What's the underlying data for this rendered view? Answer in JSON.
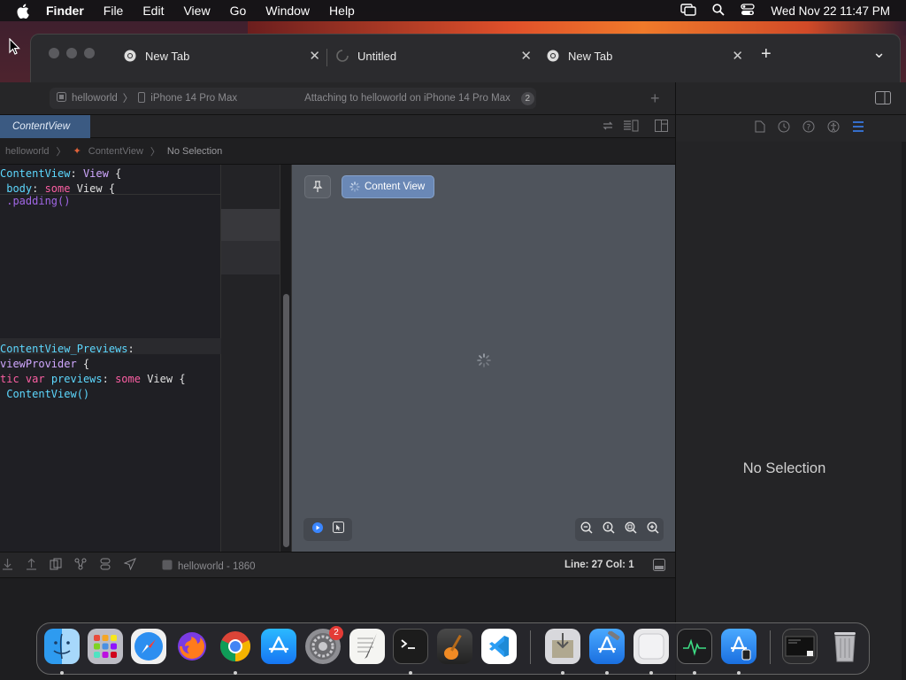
{
  "menubar": {
    "app_name": "Finder",
    "items": [
      "File",
      "Edit",
      "View",
      "Go",
      "Window",
      "Help"
    ],
    "clock": "Wed Nov 22  11:47 PM"
  },
  "browser": {
    "tabs": [
      {
        "title": "New Tab",
        "icon": "chrome-icon"
      },
      {
        "title": "Untitled",
        "icon": "loading-spinner-icon"
      },
      {
        "title": "New Tab",
        "icon": "chrome-icon"
      }
    ],
    "new_tab_symbol": "+",
    "menu_symbol": "⌄"
  },
  "xcode": {
    "toolbar": {
      "project": "helloworld",
      "device": "iPhone 14 Pro Max",
      "status": "Attaching to helloworld on iPhone 14 Pro Max",
      "status_badge": "2",
      "add_symbol": "+"
    },
    "editor_tab": "ContentView",
    "jumpbar": {
      "project": "helloworld",
      "file": "ContentView",
      "selection": "No Selection"
    },
    "code_lines": [
      [
        {
          "t": "ContentView",
          "c": "cl"
        },
        {
          "t": ": ",
          "c": ""
        },
        {
          "t": "View",
          "c": "ty"
        },
        {
          "t": " {",
          "c": ""
        }
      ],
      [
        {
          "t": " body",
          "c": "cl"
        },
        {
          "t": ": ",
          "c": ""
        },
        {
          "t": "some",
          "c": "kw"
        },
        {
          "t": " View {",
          "c": ""
        }
      ],
      [
        {
          "t": " .padding()",
          "c": "pr"
        }
      ],
      [],
      [],
      [],
      [
        {
          "t": "ContentView_Previews",
          "c": "cl"
        },
        {
          "t": ":",
          "c": ""
        }
      ],
      [
        {
          "t": "viewProvider",
          "c": "ty"
        },
        {
          "t": " {",
          "c": ""
        }
      ],
      [
        {
          "t": "tic ",
          "c": "kw"
        },
        {
          "t": "var",
          "c": "kw"
        },
        {
          "t": " previews",
          "c": "cl"
        },
        {
          "t": ": ",
          "c": ""
        },
        {
          "t": "some",
          "c": "kw"
        },
        {
          "t": " View {",
          "c": ""
        }
      ],
      [
        {
          "t": " ContentView()",
          "c": "cl"
        }
      ]
    ],
    "canvas": {
      "content_view_label": "Content View"
    },
    "debugbar": {
      "target": "helloworld - 1860",
      "line_col": "Line: 27  Col: 1"
    },
    "inspector": {
      "empty_label": "No Selection"
    }
  },
  "dock": {
    "apps": [
      {
        "name": "finder-icon"
      },
      {
        "name": "launchpad-icon"
      },
      {
        "name": "safari-icon"
      },
      {
        "name": "firefox-icon"
      },
      {
        "name": "chrome-icon"
      },
      {
        "name": "app-store-icon"
      },
      {
        "name": "system-settings-icon",
        "badge": "2"
      },
      {
        "name": "textedit-icon"
      },
      {
        "name": "terminal-icon"
      },
      {
        "name": "garageband-icon"
      },
      {
        "name": "vscode-icon"
      },
      {
        "name": "installer-icon"
      },
      {
        "name": "xcode-icon"
      },
      {
        "name": "blank-app-icon"
      },
      {
        "name": "activity-monitor-icon"
      },
      {
        "name": "simulator-icon"
      },
      {
        "name": "screen-preview-icon"
      },
      {
        "name": "trash-icon"
      }
    ]
  },
  "colors": {
    "accent_tab": "#3b5a82",
    "canvas_bg": "#4f545c",
    "content_view_button": "#6a88b6"
  }
}
